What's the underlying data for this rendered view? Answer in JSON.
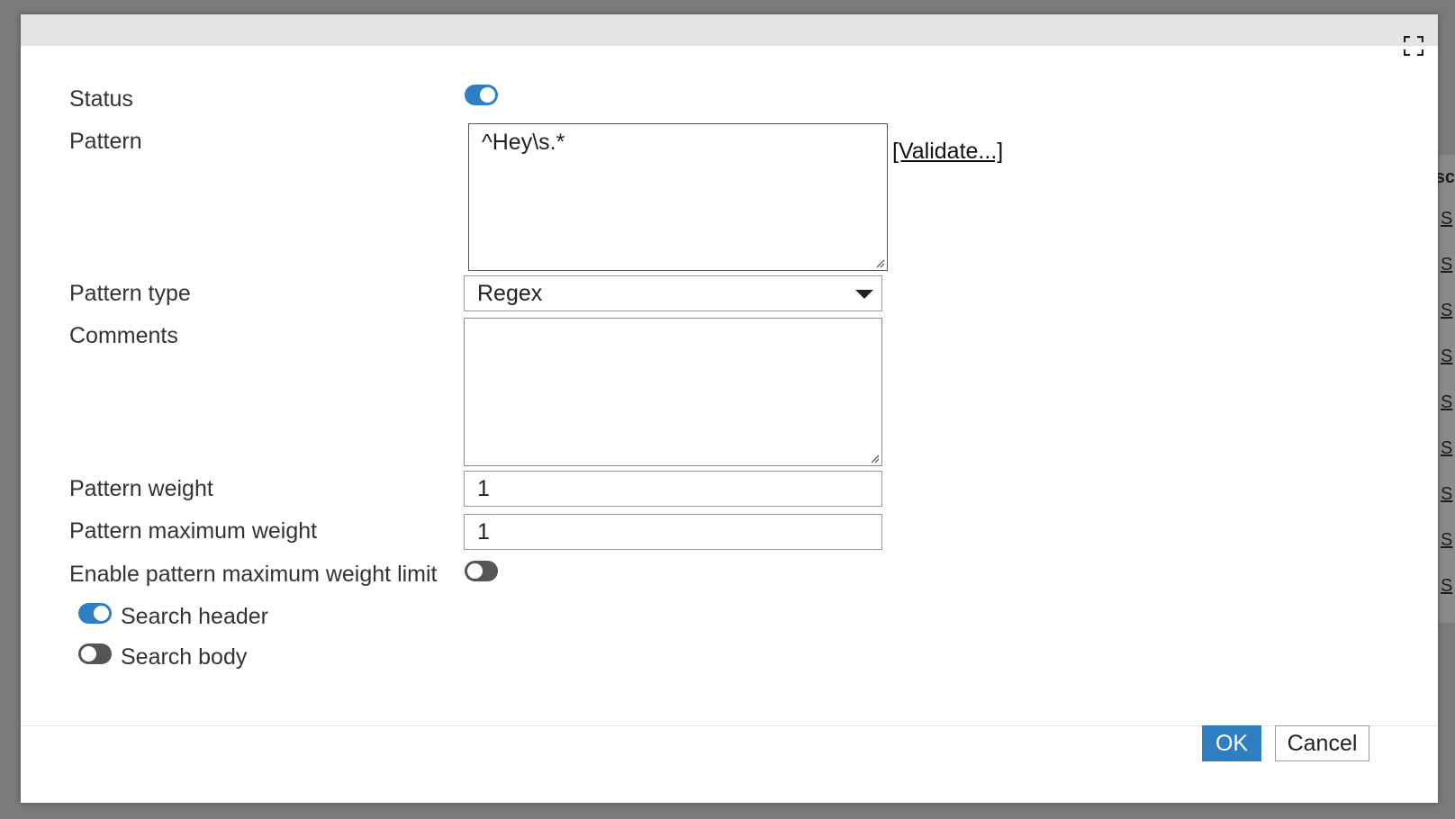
{
  "background": {
    "header_fragment": "sc",
    "links": [
      "S",
      "S",
      "S",
      "S",
      "S",
      "S",
      "S",
      "S",
      "S"
    ]
  },
  "dialog": {
    "maximize_icon": "maximize-icon",
    "fields": {
      "status": {
        "label": "Status",
        "enabled": true
      },
      "pattern": {
        "label": "Pattern",
        "value": "^Hey\\s.*",
        "validate_link": "[Validate...]"
      },
      "pattern_type": {
        "label": "Pattern type",
        "value": "Regex"
      },
      "comments": {
        "label": "Comments",
        "value": ""
      },
      "pattern_weight": {
        "label": "Pattern weight",
        "value": "1"
      },
      "pattern_max_weight": {
        "label": "Pattern maximum weight",
        "value": "1"
      },
      "enable_max_weight_limit": {
        "label": "Enable pattern maximum weight limit",
        "enabled": false
      },
      "search_header": {
        "label": "Search header",
        "enabled": true
      },
      "search_body": {
        "label": "Search body",
        "enabled": false
      }
    },
    "buttons": {
      "ok": "OK",
      "cancel": "Cancel"
    }
  },
  "colors": {
    "accent": "#2f7ec2",
    "toggle_off": "#555555",
    "titlebar": "#e4e4e4",
    "overlay": "#7a7a7a"
  }
}
